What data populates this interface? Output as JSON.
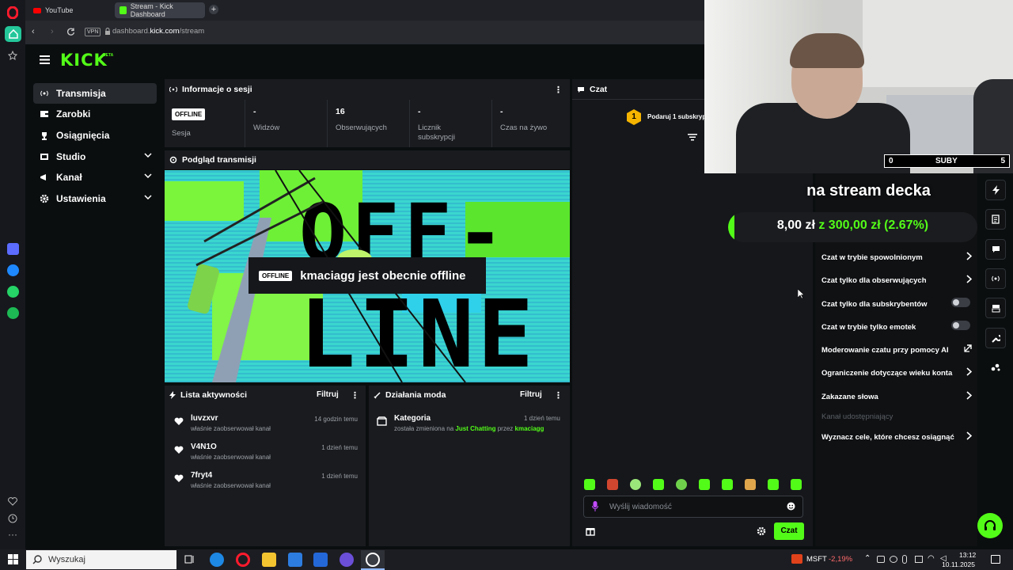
{
  "browser": {
    "tabs": [
      {
        "label": "YouTube"
      },
      {
        "label": "Stream - Kick Dashboard"
      }
    ],
    "url_prefix": "dashboard.",
    "url_domain": "kick.com",
    "url_path": "/stream",
    "vpn_label": "VPN"
  },
  "kick": {
    "logo": "KICK",
    "logo_badge": "BETA",
    "nav": [
      {
        "label": "Transmisja"
      },
      {
        "label": "Zarobki"
      },
      {
        "label": "Osiągnięcia"
      },
      {
        "label": "Studio"
      },
      {
        "label": "Kanał"
      },
      {
        "label": "Ustawienia"
      }
    ]
  },
  "session": {
    "title": "Informacje o sesji",
    "status_badge": "OFFLINE",
    "status_label": "Sesja",
    "stats": [
      {
        "value": "-",
        "label": "Widzów"
      },
      {
        "value": "16",
        "label": "Obserwujących"
      },
      {
        "value": "-",
        "label": "Licznik subskrypcji"
      },
      {
        "value": "-",
        "label": "Czas na żywo"
      }
    ]
  },
  "preview": {
    "title": "Podgląd transmisji",
    "offline_badge": "OFFLINE",
    "offline_message": "kmaciagg jest obecnie offline",
    "bg_word_1": "OFF-",
    "bg_word_2": "LINE"
  },
  "activity": {
    "title": "Lista aktywności",
    "filter_label": "Filtruj",
    "items": [
      {
        "name": "luvzxvr",
        "desc": "właśnie zaobserwował kanał",
        "time": "14 godzin temu"
      },
      {
        "name": "V4N1O",
        "desc": "właśnie zaobserwował kanał",
        "time": "1 dzień temu"
      },
      {
        "name": "7fryt4",
        "desc": "właśnie zaobserwował kanał",
        "time": "1 dzień temu"
      }
    ]
  },
  "mod": {
    "title": "Działania moda",
    "filter_label": "Filtruj",
    "item": {
      "name": "Kategoria",
      "desc_prefix": "została zmieniona na",
      "category": "Just Chatting",
      "by": "przez",
      "user": "kmaciagg",
      "time": "1 dzień temu"
    }
  },
  "chat": {
    "title": "Czat",
    "gift_text": "Podaruj 1 subskryp",
    "gift_count": "1",
    "input_placeholder": "Wyślij wiadomość",
    "send_label": "Czat"
  },
  "chat_settings": {
    "items": [
      {
        "label": "Czat w trybie spowolnionym",
        "control": "arrow"
      },
      {
        "label": "Czat tylko dla obserwujących",
        "control": "arrow"
      },
      {
        "label": "Czat tylko dla subskrybentów",
        "control": "toggle",
        "on": false
      },
      {
        "label": "Czat w trybie tylko emotek",
        "control": "toggle",
        "on": false
      },
      {
        "label": "Moderowanie czatu przy pomocy AI",
        "control": "external"
      },
      {
        "label": "Ograniczenie dotyczące wieku konta",
        "control": "arrow"
      },
      {
        "label": "Zakazane słowa",
        "control": "arrow"
      },
      {
        "label": "Kanał udostępniający",
        "control": "none",
        "disabled": true
      },
      {
        "label": "Wyznacz cele, które chcesz osiągnąć",
        "control": "arrow"
      }
    ]
  },
  "overlay": {
    "sub_left": "0",
    "sub_label": "SUBY",
    "sub_right": "5",
    "goal_title": "na stream decka",
    "goal_current": "8,00 zł",
    "goal_of": "z 300,00 zł",
    "goal_percent": "(2.67%)",
    "goal_progress": 0.0267
  },
  "taskbar": {
    "search_placeholder": "Wyszukaj",
    "stock_name": "MSFT",
    "stock_change": "-2,19%",
    "time": "13:12",
    "date": "10.11.2025"
  },
  "colors": {
    "kick_green": "#53fc18",
    "panel": "#191b1f",
    "background": "#0b0e0f",
    "stock_negative": "#ff6b6b"
  }
}
